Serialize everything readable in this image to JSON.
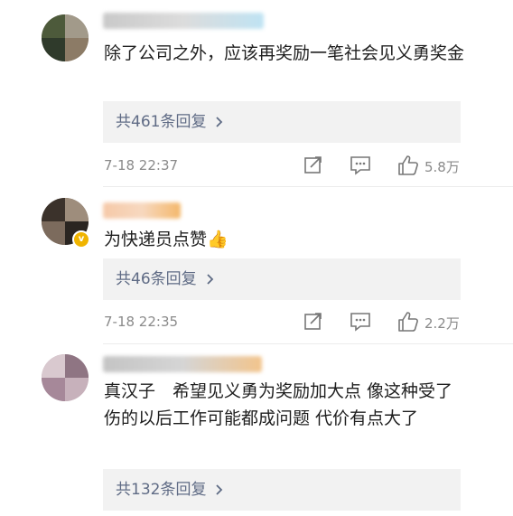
{
  "comments": [
    {
      "text": "除了公司之外，应该再奖励一笔社会见义勇奖金",
      "reply_link": "共461条回复",
      "time": "7-18 22:37",
      "likes": "5.8万"
    },
    {
      "text": "为快递员点赞👍",
      "reply_link": "共46条回复",
      "time": "7-18 22:35",
      "likes": "2.2万"
    },
    {
      "text": "真汉子　希望见义勇为奖励加大点 像这种受了伤的以后工作可能都成问题 代价有点大了",
      "reply_link": "共132条回复"
    }
  ],
  "icons": {
    "share": "share-icon",
    "comment": "comment-icon",
    "like": "thumbs-up-icon",
    "reply_chevron": "chevron-right-icon"
  },
  "colors": {
    "reply_link": "#5f6b85",
    "meta": "#8a8a8a",
    "reply_bg": "#f2f2f2",
    "verified_badge": "#f0b400"
  }
}
